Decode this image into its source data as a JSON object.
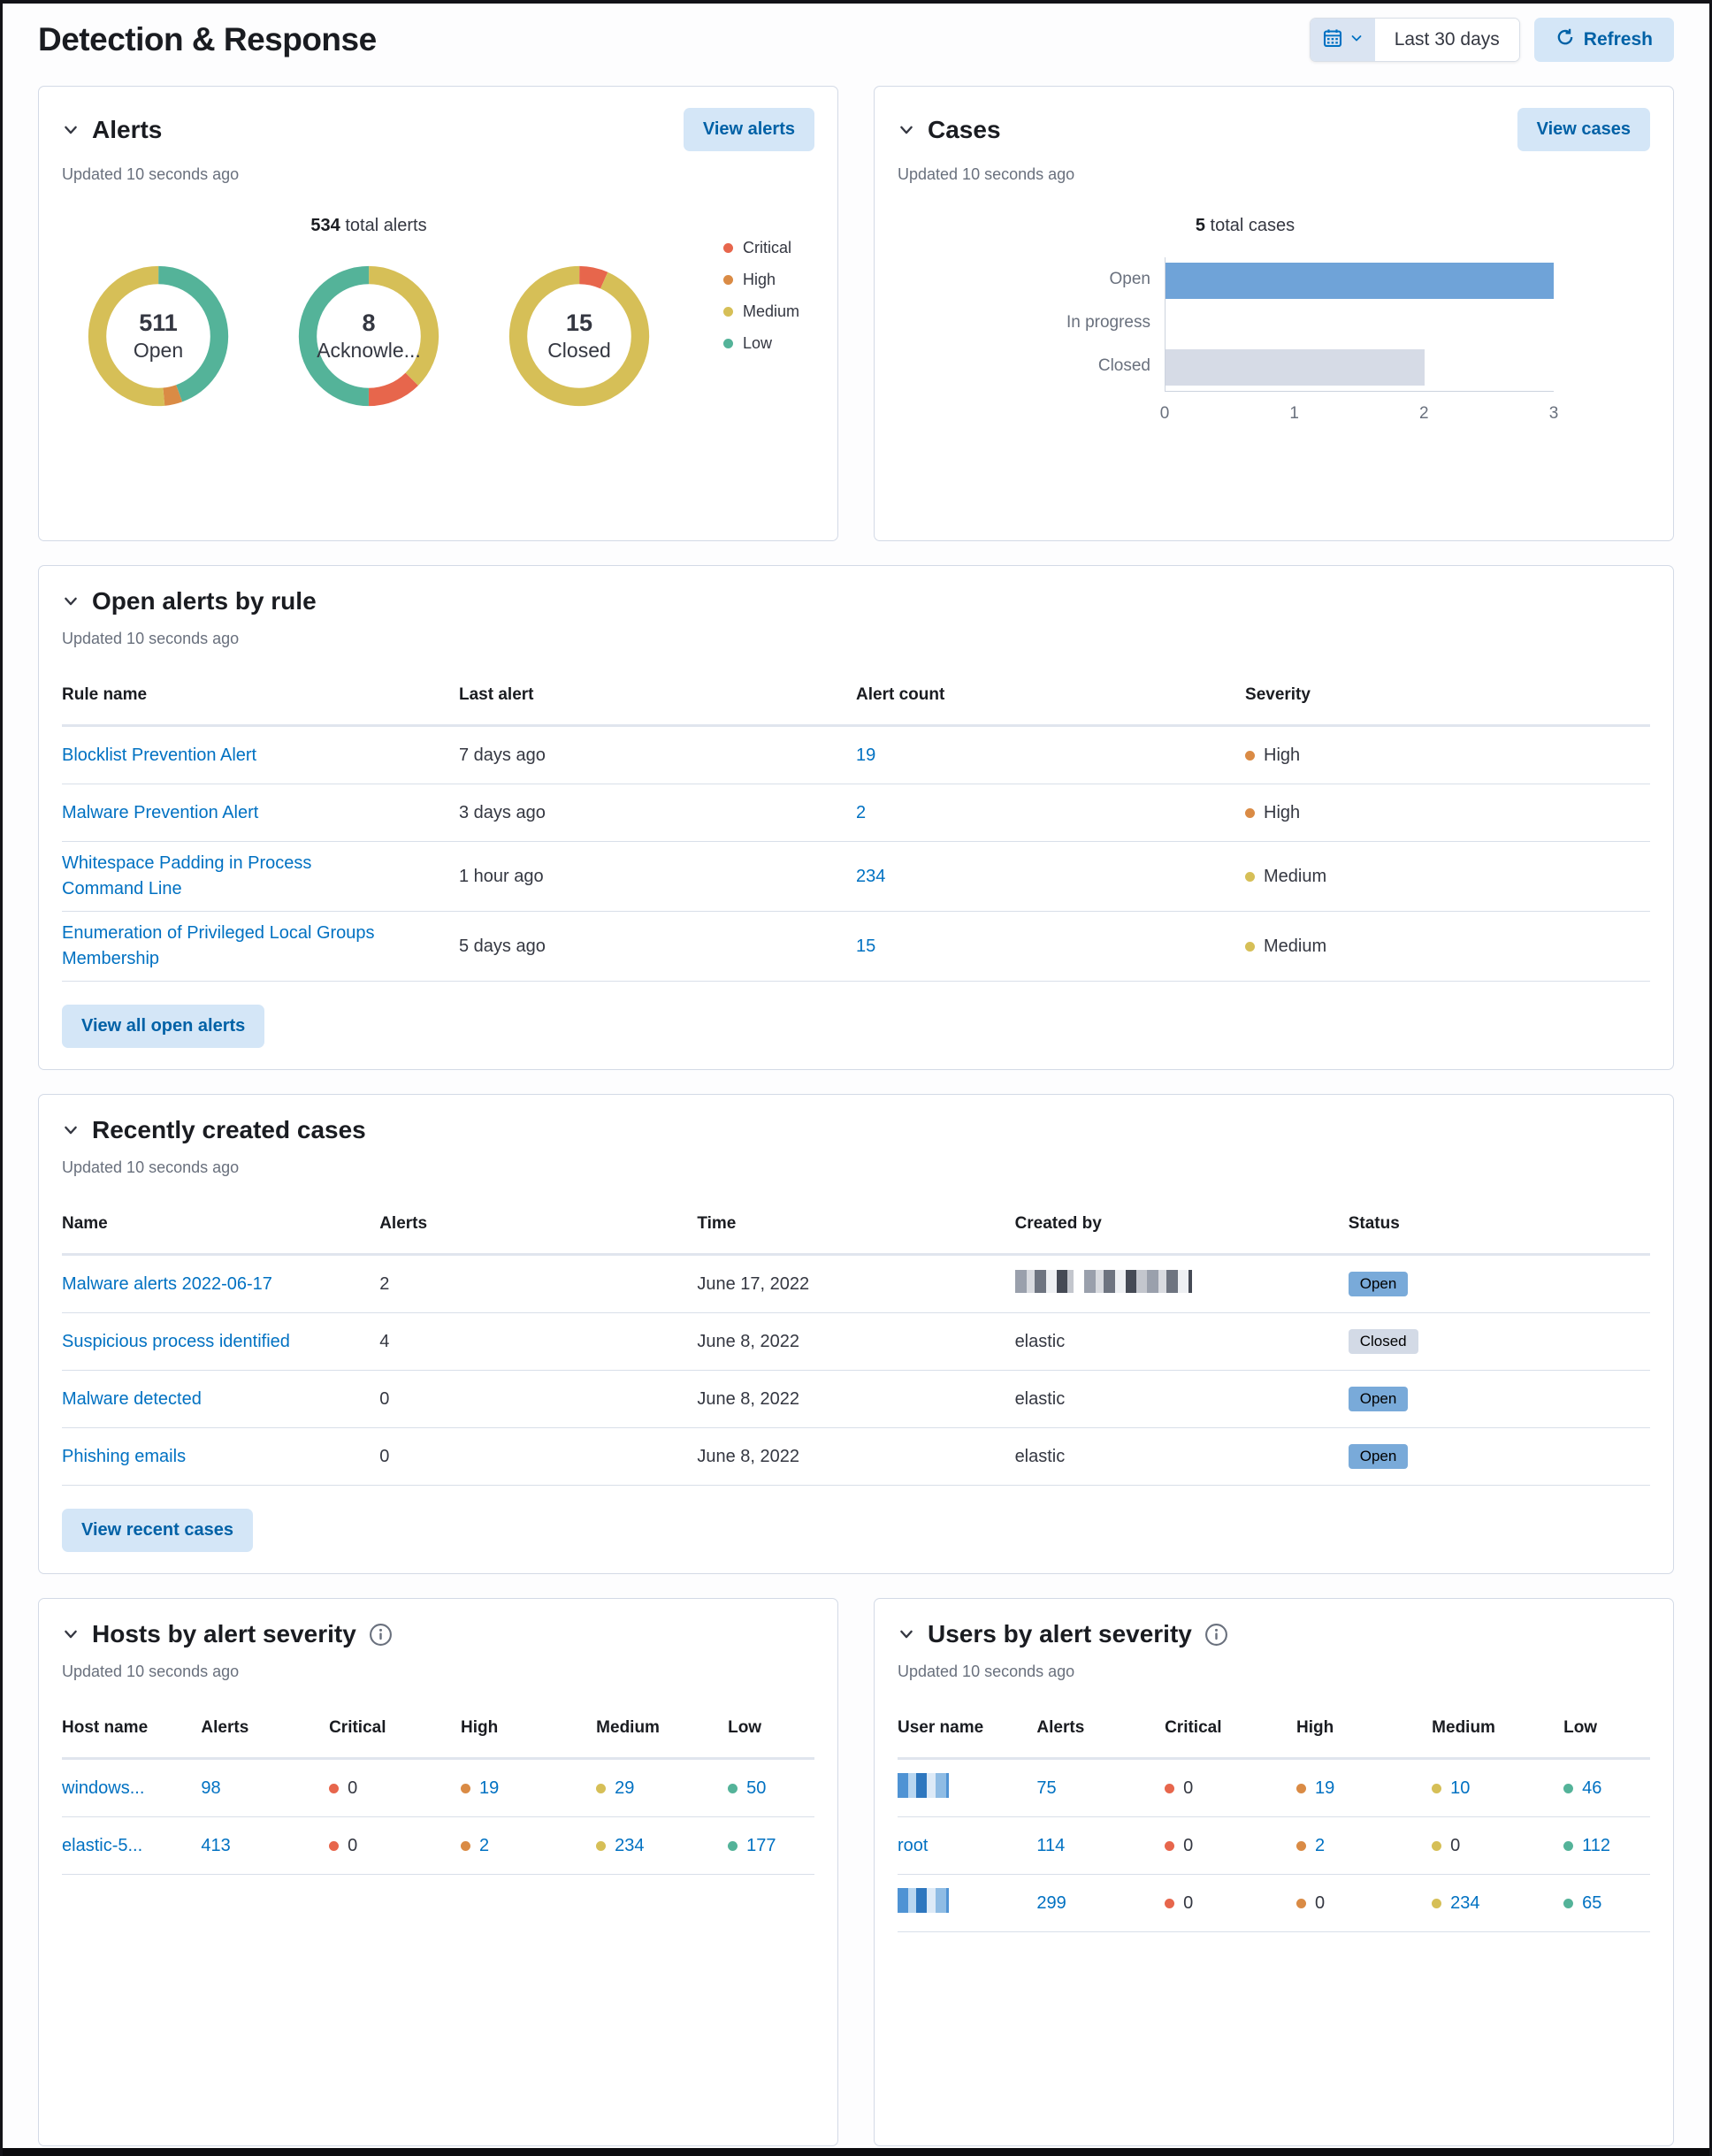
{
  "header": {
    "title": "Detection & Response",
    "date_range": "Last 30 days",
    "refresh_label": "Refresh"
  },
  "icons": {
    "calendar": "calendar-icon",
    "chevron": "chevron-down-icon",
    "refresh": "refresh-icon",
    "info": "info-icon"
  },
  "severity_colors": {
    "Critical": "#E7664C",
    "High": "#DA8B45",
    "Medium": "#D6BF57",
    "Low": "#54B399"
  },
  "status_badge_colors": {
    "Open": "#79AAD9",
    "Closed": "#D3DAE6"
  },
  "alerts_panel": {
    "title": "Alerts",
    "button": "View alerts",
    "updated": "Updated 10 seconds ago",
    "total_value": "534",
    "total_label": "total alerts",
    "legend": [
      "Critical",
      "High",
      "Medium",
      "Low"
    ]
  },
  "cases_panel": {
    "title": "Cases",
    "button": "View cases",
    "updated": "Updated 10 seconds ago",
    "total_value": "5",
    "total_label": "total cases"
  },
  "open_alerts_panel": {
    "title": "Open alerts by rule",
    "updated": "Updated 10 seconds ago",
    "columns": [
      "Rule name",
      "Last alert",
      "Alert count",
      "Severity"
    ],
    "rows": [
      {
        "rule": "Blocklist Prevention Alert",
        "last_alert": "7 days ago",
        "count": "19",
        "severity": "High"
      },
      {
        "rule": "Malware Prevention Alert",
        "last_alert": "3 days ago",
        "count": "2",
        "severity": "High"
      },
      {
        "rule": "Whitespace Padding in Process Command Line",
        "last_alert": "1 hour ago",
        "count": "234",
        "severity": "Medium"
      },
      {
        "rule": "Enumeration of Privileged Local Groups Membership",
        "last_alert": "5 days ago",
        "count": "15",
        "severity": "Medium"
      }
    ],
    "button": "View all open alerts"
  },
  "recent_cases_panel": {
    "title": "Recently created cases",
    "updated": "Updated 10 seconds ago",
    "columns": [
      "Name",
      "Alerts",
      "Time",
      "Created by",
      "Status"
    ],
    "rows": [
      {
        "name": "Malware alerts 2022-06-17",
        "alerts": "2",
        "time": "June 17, 2022",
        "created_by": "",
        "created_by_redacted": true,
        "status": "Open"
      },
      {
        "name": "Suspicious process identified",
        "alerts": "4",
        "time": "June 8, 2022",
        "created_by": "elastic",
        "created_by_redacted": false,
        "status": "Closed"
      },
      {
        "name": "Malware detected",
        "alerts": "0",
        "time": "June 8, 2022",
        "created_by": "elastic",
        "created_by_redacted": false,
        "status": "Open"
      },
      {
        "name": "Phishing emails",
        "alerts": "0",
        "time": "June 8, 2022",
        "created_by": "elastic",
        "created_by_redacted": false,
        "status": "Open"
      }
    ],
    "button": "View recent cases"
  },
  "hosts_panel": {
    "title": "Hosts by alert severity",
    "updated": "Updated 10 seconds ago",
    "columns": [
      "Host name",
      "Alerts",
      "Critical",
      "High",
      "Medium",
      "Low"
    ],
    "rows": [
      {
        "name": "windows...",
        "name_redacted": false,
        "alerts": "98",
        "critical": "0",
        "high": "19",
        "medium": "29",
        "low": "50"
      },
      {
        "name": "elastic-5...",
        "name_redacted": false,
        "alerts": "413",
        "critical": "0",
        "high": "2",
        "medium": "234",
        "low": "177"
      }
    ]
  },
  "users_panel": {
    "title": "Users by alert severity",
    "updated": "Updated 10 seconds ago",
    "columns": [
      "User name",
      "Alerts",
      "Critical",
      "High",
      "Medium",
      "Low"
    ],
    "rows": [
      {
        "name": "",
        "name_redacted": true,
        "alerts": "75",
        "critical": "0",
        "high": "19",
        "medium": "10",
        "low": "46"
      },
      {
        "name": "root",
        "name_redacted": false,
        "alerts": "114",
        "critical": "0",
        "high": "2",
        "medium": "0",
        "low": "112"
      },
      {
        "name": "",
        "name_redacted": true,
        "alerts": "299",
        "critical": "0",
        "high": "0",
        "medium": "234",
        "low": "65"
      }
    ]
  },
  "chart_data": [
    {
      "type": "pie",
      "variant": "donut",
      "panel": "Alerts",
      "title": "534 total alerts",
      "legend": [
        "Critical",
        "High",
        "Medium",
        "Low"
      ],
      "legend_position": "right",
      "colors": {
        "Critical": "#E7664C",
        "High": "#DA8B45",
        "Medium": "#D6BF57",
        "Low": "#54B399"
      },
      "donuts": [
        {
          "center_value": "511",
          "center_label": "Open",
          "slices": [
            {
              "name": "Low",
              "value": 227
            },
            {
              "name": "High",
              "value": 21
            },
            {
              "name": "Medium",
              "value": 263
            }
          ]
        },
        {
          "center_value": "8",
          "center_label": "Acknowle...",
          "slices": [
            {
              "name": "Medium",
              "value": 3
            },
            {
              "name": "Critical",
              "value": 1
            },
            {
              "name": "Low",
              "value": 4
            }
          ]
        },
        {
          "center_value": "15",
          "center_label": "Closed",
          "slices": [
            {
              "name": "Critical",
              "value": 1
            },
            {
              "name": "Medium",
              "value": 14
            }
          ]
        }
      ]
    },
    {
      "type": "bar",
      "orientation": "horizontal",
      "panel": "Cases",
      "title": "5 total cases",
      "categories": [
        "Open",
        "In progress",
        "Closed"
      ],
      "values": [
        3,
        0,
        2
      ],
      "bar_colors": [
        "#6FA3D8",
        "#6FA3D8",
        "#D6DBE6"
      ],
      "xlim": [
        0,
        3
      ],
      "xticks": [
        0,
        1,
        2,
        3
      ],
      "grid": false,
      "legend": "none"
    }
  ]
}
